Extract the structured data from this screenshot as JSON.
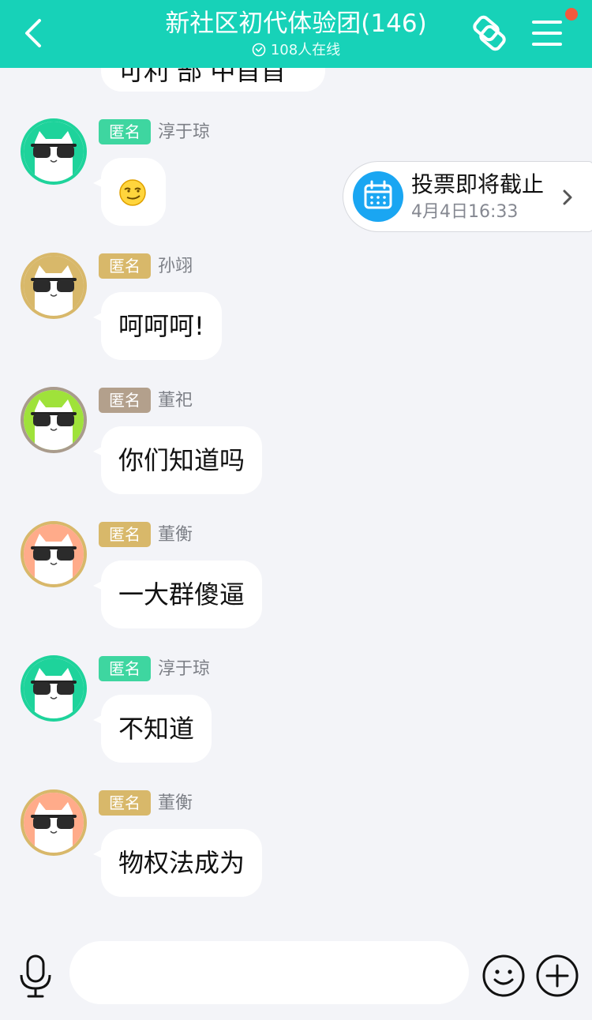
{
  "header": {
    "title": "新社区初代体验团(146)",
    "online": "108人在线",
    "background": "#17d2b8"
  },
  "partial_message": {
    "text": "可利  部 中首首"
  },
  "vote_card": {
    "title": "投票即将截止",
    "time": "4月4日16:33",
    "icon": "calendar-icon"
  },
  "messages": [
    {
      "tag": "匿名",
      "tag_color": "#3ed6a0",
      "name": "淳于琼",
      "text": "😏",
      "avatar_bg": "#1ed39b",
      "avatar_ring": "#1ed39b"
    },
    {
      "tag": "匿名",
      "tag_color": "#d8b86a",
      "name": "孙翊",
      "text": "呵呵呵!",
      "avatar_bg": "#d8b86a",
      "avatar_ring": "#d8b86a"
    },
    {
      "tag": "匿名",
      "tag_color": "#b3a08c",
      "name": "董祀",
      "text": "你们知道吗",
      "avatar_bg": "#9fe23a",
      "avatar_ring": "#a99b8c"
    },
    {
      "tag": "匿名",
      "tag_color": "#d8b86a",
      "name": "董衡",
      "text": "一大群傻逼",
      "avatar_bg": "#ffab8a",
      "avatar_ring": "#d8b86a"
    },
    {
      "tag": "匿名",
      "tag_color": "#3ed6a0",
      "name": "淳于琼",
      "text": "不知道",
      "avatar_bg": "#1ed39b",
      "avatar_ring": "#1ed39b"
    },
    {
      "tag": "匿名",
      "tag_color": "#d8b86a",
      "name": "董衡",
      "text": "物权法成为",
      "avatar_bg": "#ffab8a",
      "avatar_ring": "#d8b86a"
    }
  ],
  "input": {
    "placeholder": ""
  }
}
